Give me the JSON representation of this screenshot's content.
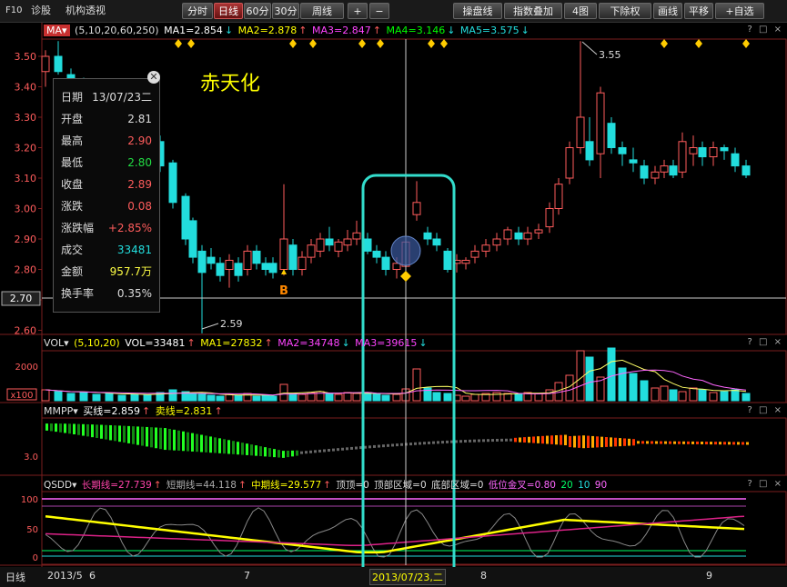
{
  "colors": {
    "up": "#ff5c5c",
    "down": "#22dddd",
    "ma1": "#ffffff",
    "ma2": "#ffff00",
    "ma3": "#ff44ff",
    "ma4": "#00ff00",
    "ma5": "#888888",
    "accent": "#e03030",
    "highlight": "#33ddcc"
  },
  "toolbar": {
    "f10": "F10",
    "diagnose": "诊股",
    "institution": "机构透视",
    "fenshi": "分时",
    "rixian": "日线",
    "m60": "60分",
    "m30": "30分",
    "zhouxian": "周线",
    "plus": "+",
    "minus": "−",
    "caopanxian": "操盘线",
    "zhibiao": "指数叠加",
    "four": "4图",
    "xiachuquan": "下除权",
    "huaxian": "画线",
    "pingyi": "平移",
    "zixuan": "+自选"
  },
  "main_legend": {
    "ma_btn": "MA▾",
    "params": "(5,10,20,60,250)",
    "ma1": "MA1=2.854",
    "ma1_arrow": "↓",
    "ma2": "MA2=2.878",
    "ma2_arrow": "↑",
    "ma3": "MA3=2.847",
    "ma3_arrow": "↑",
    "ma4": "MA4=3.146",
    "ma4_arrow": "↓",
    "ma5": "MA5=3.575",
    "ma5_arrow": "↓"
  },
  "stock_name": "赤天化",
  "price_axis": {
    "labels": [
      "3.50",
      "3.40",
      "3.30",
      "3.20",
      "3.10",
      "3.00",
      "2.90",
      "2.80",
      "2.70",
      "2.60"
    ],
    "current": "2.70"
  },
  "annotations": {
    "high": "3.55",
    "low": "2.59",
    "buy": "B"
  },
  "infobox": {
    "rows": [
      {
        "label": "日期",
        "value": "13/07/23二"
      },
      {
        "label": "开盘",
        "value": "2.81"
      },
      {
        "label": "最高",
        "value": "2.90"
      },
      {
        "label": "最低",
        "value": "2.80"
      },
      {
        "label": "收盘",
        "value": "2.89"
      },
      {
        "label": "涨跌",
        "value": "0.08"
      },
      {
        "label": "涨跌幅",
        "value": "+2.85%"
      },
      {
        "label": "成交",
        "value": "33481"
      },
      {
        "label": "金额",
        "value": "957.7万"
      },
      {
        "label": "换手率",
        "value": "0.35%"
      }
    ],
    "close": "✕"
  },
  "vol_legend": {
    "btn": "VOL▾",
    "params": "(5,10,20)",
    "vol": "VOL=33481",
    "vol_arrow": "↑",
    "ma1": "MA1=27832",
    "ma1_arrow": "↑",
    "ma2": "MA2=34748",
    "ma2_arrow": "↓",
    "ma3": "MA3=39615",
    "ma3_arrow": "↓",
    "axis_top": "2000",
    "axis_unit": "x100"
  },
  "mmpp_legend": {
    "btn": "MMPP▾",
    "buy": "买线=2.859",
    "buy_arrow": "↑",
    "sell": "卖线=2.831",
    "sell_arrow": "↑",
    "axis": "3.0"
  },
  "qsdd_legend": {
    "btn": "QSDD▾",
    "long": "长期线=27.739",
    "long_arrow": "↑",
    "short": "短期线=44.118",
    "short_arrow": "↑",
    "mid": "中期线=29.577",
    "mid_arrow": "↑",
    "top": "顶顶=0",
    "top_zone": "顶部区域=0",
    "bottom_zone": "底部区域=0",
    "low_gold": "低位金叉=0.80",
    "p20": "20",
    "p10": "10",
    "p90": "90",
    "axis": [
      "100",
      "50",
      "0"
    ]
  },
  "date_axis": {
    "period": "日线",
    "labels": [
      "2013/5",
      "6",
      "7",
      "8",
      "9"
    ],
    "selected": "2013/07/23,二"
  },
  "panel_controls": "? □ ×"
}
